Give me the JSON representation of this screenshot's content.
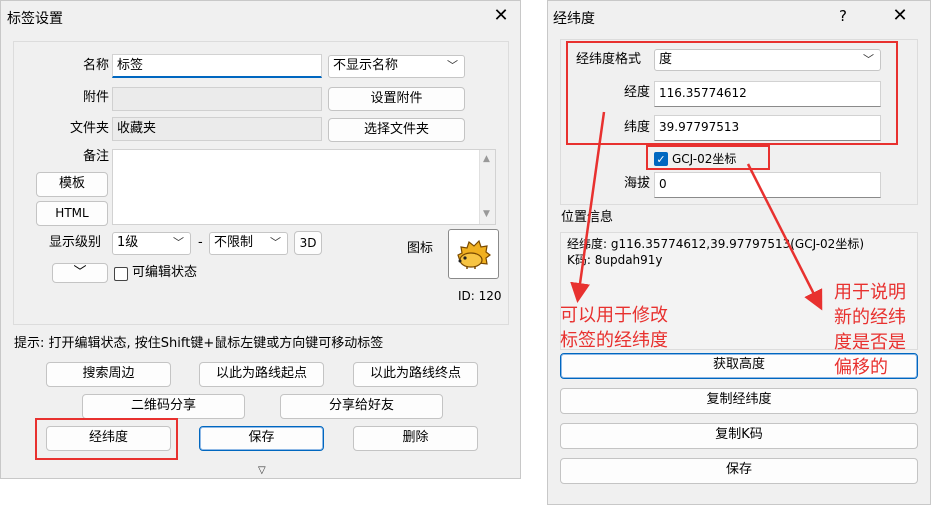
{
  "left_dialog": {
    "title": "标签设置",
    "name_label": "名称",
    "name_value": "标签",
    "name_display_select": "不显示名称",
    "attach_label": "附件",
    "attach_value": "",
    "attach_button": "设置附件",
    "folder_label": "文件夹",
    "folder_value": "收藏夹",
    "folder_button": "选择文件夹",
    "note_label": "备注",
    "note_value": "",
    "template_button": "模板",
    "html_button": "HTML",
    "display_level_label": "显示级别",
    "level_from": "1级",
    "level_dash": "-",
    "level_to": "不限制",
    "btn_3d": "3D",
    "icon_label": "图标",
    "id_text": "ID: 120",
    "editable_label": "可编辑状态",
    "hint": "提示: 打开编辑状态, 按住Shift键+鼠标左键或方向键可移动标签",
    "buttons": {
      "search_nearby": "搜索周边",
      "route_start": "以此为路线起点",
      "route_end": "以此为路线终点",
      "qr_share": "二维码分享",
      "share_friend": "分享给好友",
      "latlng": "经纬度",
      "save": "保存",
      "delete": "删除"
    }
  },
  "right_dialog": {
    "title": "经纬度",
    "format_label": "经纬度格式",
    "format_value": "度",
    "lng_label": "经度",
    "lng_value": "116.35774612",
    "lat_label": "纬度",
    "lat_value": "39.97797513",
    "gcj_label": "GCJ-02坐标",
    "gcj_checked": true,
    "alt_label": "海拔",
    "alt_value": "0",
    "location_info_label": "位置信息",
    "info_line1": "经纬度: g116.35774612,39.97797513(GCJ-02坐标)",
    "info_line2": "K码: 8updah91y",
    "buttons": {
      "get_altitude": "获取高度",
      "copy_latlng": "复制经纬度",
      "copy_kcode": "复制K码",
      "save": "保存"
    }
  },
  "annotations": {
    "note1_line1": "可以用于修改",
    "note1_line2": "标签的经纬度",
    "note2_line1": "用于说明",
    "note2_line2": "新的经纬",
    "note2_line3": "度是否是",
    "note2_line4": "偏移的"
  },
  "colors": {
    "annotation_red": "#e8312f",
    "accent_blue": "#0067c0"
  }
}
